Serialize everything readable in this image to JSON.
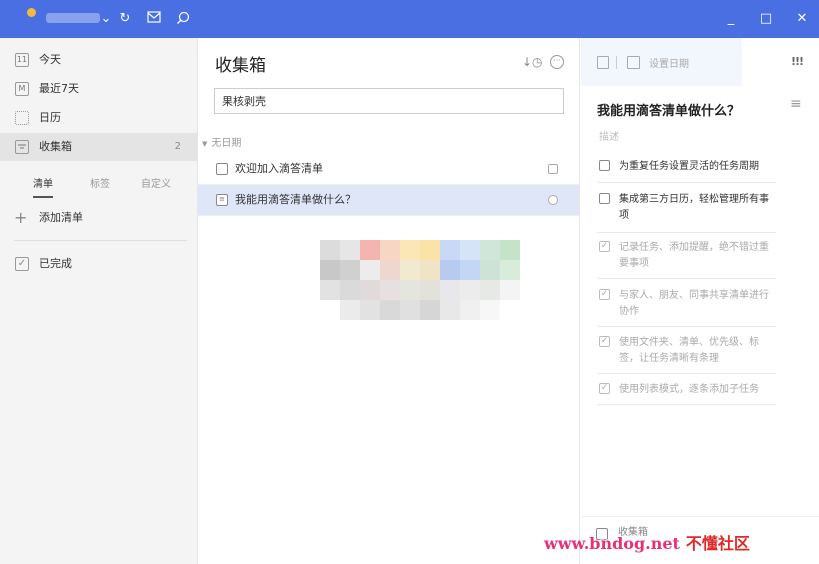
{
  "titlebar": {
    "username": "username",
    "icons": [
      "chevron-down-icon",
      "sync-icon",
      "mail-icon",
      "search-icon"
    ],
    "window_controls": {
      "minimize": "_",
      "maximize": "□",
      "close": "✕"
    },
    "background": "#4a6fe3"
  },
  "sidebar": {
    "items": [
      {
        "label": "今天",
        "icon": "calendar-today-icon",
        "icon_text": "11"
      },
      {
        "label": "最近7天",
        "icon": "calendar-week-icon",
        "icon_text": "M"
      },
      {
        "label": "日历",
        "icon": "calendar-icon",
        "icon_text": ""
      },
      {
        "label": "收集箱",
        "icon": "inbox-icon",
        "icon_text": "",
        "count": "2"
      }
    ],
    "tabs": [
      {
        "label": "清单"
      },
      {
        "label": "标签"
      },
      {
        "label": "自定义"
      }
    ],
    "add_list": "添加清单",
    "completed": "已完成"
  },
  "main": {
    "title": "收集箱",
    "input_value": "果核剥壳",
    "group": "无日期",
    "tasks": [
      {
        "label": "欢迎加入滴答清单"
      },
      {
        "label": "我能用滴答清单做什么？"
      }
    ]
  },
  "detail": {
    "date_placeholder": "设置日期",
    "priority": "!!!",
    "title": "我能用滴答清单做什么？",
    "description_placeholder": "描述",
    "subtasks": [
      {
        "text": "为重复任务设置灵活的任务周期",
        "done": false
      },
      {
        "text": "集成第三方日历，轻松管理所有事项",
        "done": false
      },
      {
        "text": "记录任务、添加提醒，绝不错过重要事项",
        "done": true
      },
      {
        "text": "与家人、朋友、同事共享清单进行协作",
        "done": true
      },
      {
        "text": "使用文件夹、清单、优先级、标签，让任务清晰有条理",
        "done": true
      },
      {
        "text": "使用列表模式，逐条添加子任务",
        "done": true
      }
    ],
    "footer_list": "收集箱"
  },
  "watermark": {
    "latin": "www.bndog.net",
    "cn": "不懂社区"
  },
  "colors": {
    "accent": "#4a6fe3",
    "selected_row": "#dfe6f8",
    "sidebar_bg": "#f4f4f4"
  }
}
